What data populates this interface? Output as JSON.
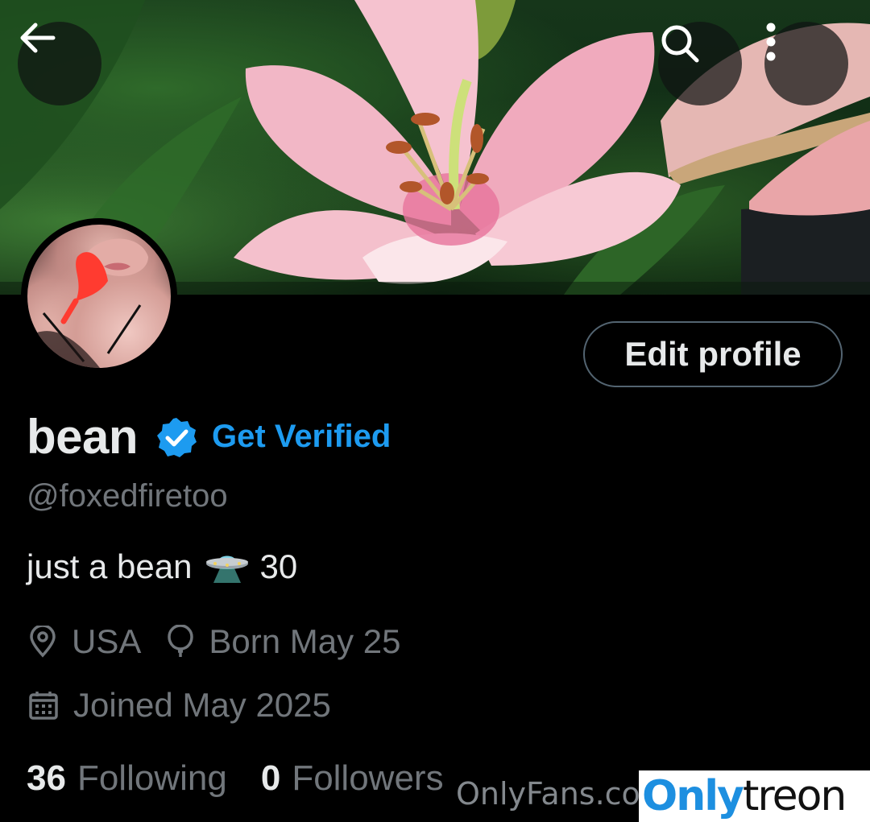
{
  "header": {
    "back_icon": "arrow-left-icon",
    "search_icon": "search-icon",
    "more_icon": "more-vertical-icon"
  },
  "profile": {
    "display_name": "bean",
    "verified_icon": "verified-badge-icon",
    "get_verified_label": "Get Verified",
    "handle": "@foxedfiretoo",
    "bio_text": "just a bean",
    "bio_emoji": "ufo-emoji",
    "bio_suffix": "30",
    "location": "USA",
    "birthday": "Born May 25",
    "joined": "Joined May 2025",
    "edit_profile_label": "Edit profile"
  },
  "stats": {
    "following_count": "36",
    "following_label": "Following",
    "followers_count": "0",
    "followers_label": "Followers"
  },
  "watermark": {
    "site_text": "OnlyFans.co",
    "logo_part1": "Only",
    "logo_part2": "treon"
  },
  "colors": {
    "background": "#000000",
    "primary_text": "#e7e9ea",
    "secondary_text": "#71767b",
    "accent": "#1d9bf0",
    "button_border": "#536471"
  }
}
